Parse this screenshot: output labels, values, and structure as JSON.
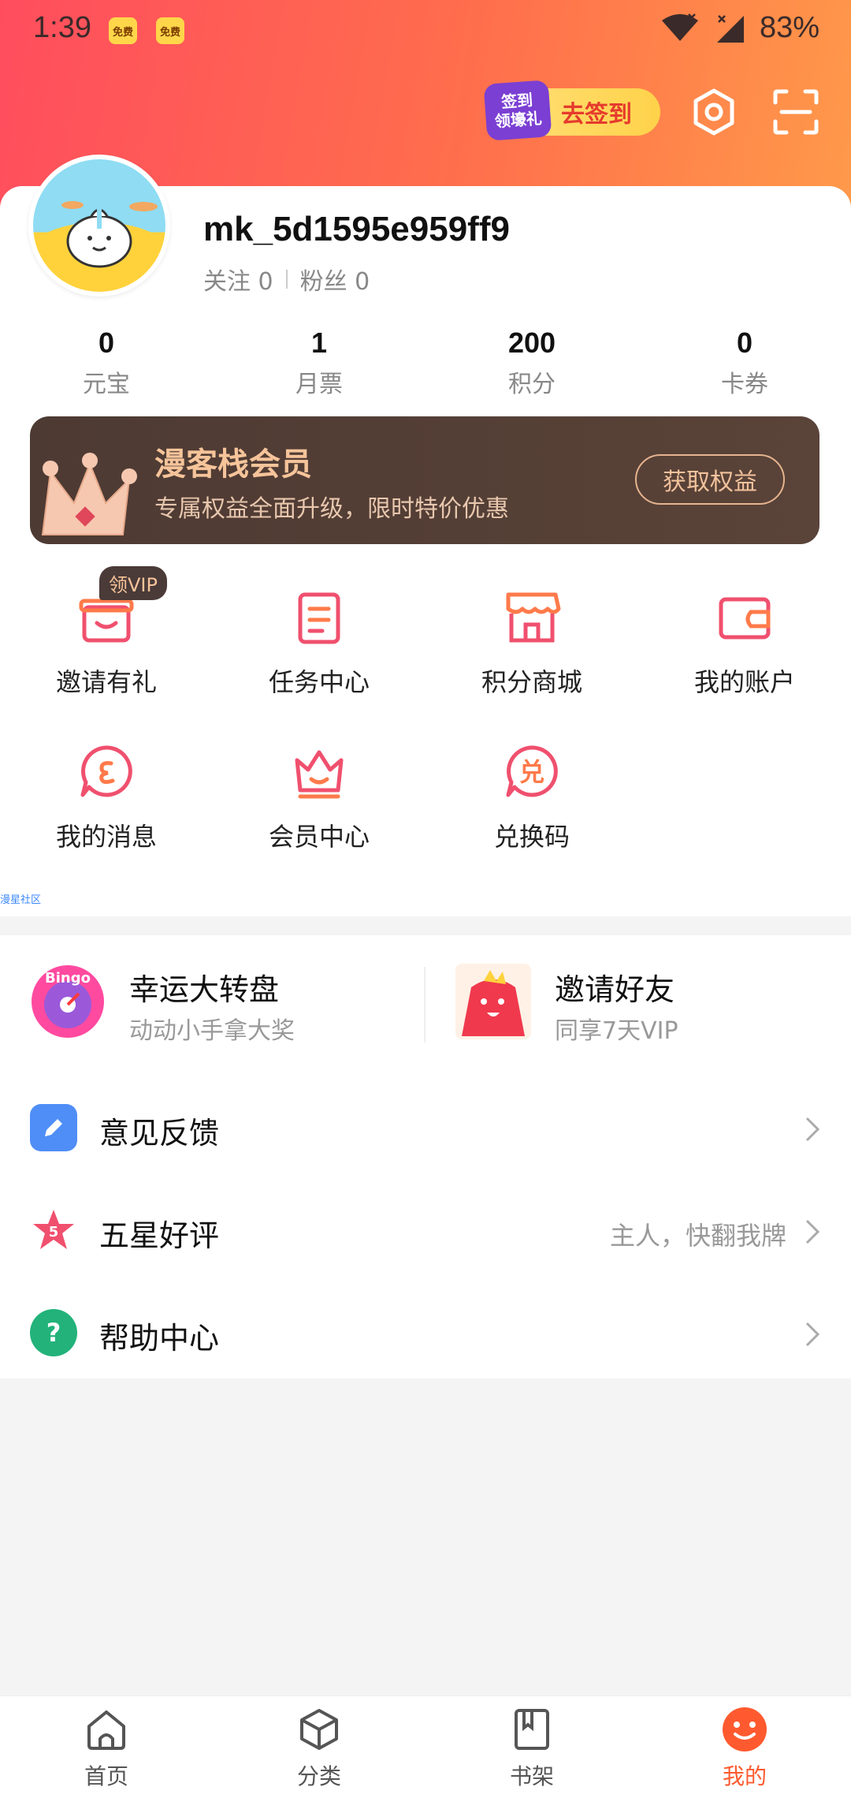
{
  "status_bar": {
    "time": "1:39",
    "badges": [
      "免费",
      "免费"
    ],
    "battery": "83%"
  },
  "top_actions": {
    "checkin_tag_line1": "签到",
    "checkin_tag_line2": "领壕礼",
    "checkin_label": "去签到"
  },
  "profile": {
    "username": "mk_5d1595e959ff9",
    "follow_label": "关注 0",
    "fans_label": "粉丝 0"
  },
  "stats": [
    {
      "value": "0",
      "label": "元宝"
    },
    {
      "value": "1",
      "label": "月票"
    },
    {
      "value": "200",
      "label": "积分"
    },
    {
      "value": "0",
      "label": "卡券"
    }
  ],
  "vip_banner": {
    "title": "漫客栈会员",
    "subtitle": "专属权益全面升级，限时特价优惠",
    "button": "获取权益"
  },
  "grid": {
    "vip_tag": "领VIP",
    "items": [
      {
        "label": "邀请有礼",
        "icon": "gift-box-icon"
      },
      {
        "label": "任务中心",
        "icon": "clipboard-icon"
      },
      {
        "label": "积分商城",
        "icon": "store-icon"
      },
      {
        "label": "我的账户",
        "icon": "wallet-icon"
      },
      {
        "label": "我的消息",
        "icon": "message-icon"
      },
      {
        "label": "会员中心",
        "icon": "crown-icon"
      },
      {
        "label": "兑换码",
        "icon": "redeem-icon"
      }
    ],
    "community_link": "漫星社区"
  },
  "activities": [
    {
      "title": "幸运大转盘",
      "subtitle": "动动小手拿大奖",
      "badge": "Bingo"
    },
    {
      "title": "邀请好友",
      "subtitle": "同享7天VIP"
    }
  ],
  "menu": [
    {
      "label": "意见反馈",
      "hint": "",
      "icon": "pencil-icon",
      "color": "#4f8ef7"
    },
    {
      "label": "五星好评",
      "hint": "主人，快翻我牌",
      "icon": "star-icon",
      "color": "#f0506e",
      "badge": "5"
    },
    {
      "label": "帮助中心",
      "hint": "",
      "icon": "question-icon",
      "color": "#22b27a",
      "badge": "?"
    }
  ],
  "bottom_nav": [
    {
      "label": "首页",
      "icon": "home-icon"
    },
    {
      "label": "分类",
      "icon": "cube-icon"
    },
    {
      "label": "书架",
      "icon": "bookshelf-icon"
    },
    {
      "label": "我的",
      "icon": "profile-face-icon",
      "active": true
    }
  ],
  "colors": {
    "accent": "#ff5a2f",
    "header_start": "#ff4d5e",
    "header_end": "#ff9a4a",
    "vip_bg": "#4d3a33",
    "vip_text": "#f6c49a"
  }
}
